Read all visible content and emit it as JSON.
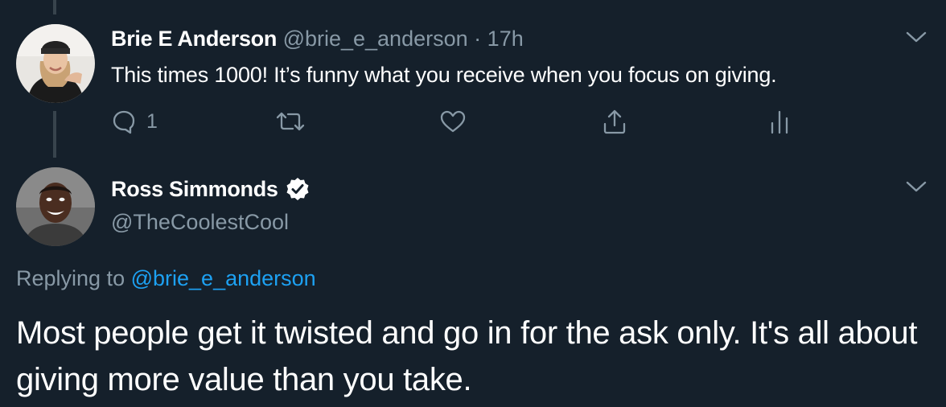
{
  "tweet1": {
    "name": "Brie E Anderson",
    "handle": "@brie_e_anderson",
    "separator": "·",
    "time": "17h",
    "text": "This times 1000! It’s funny what you receive when you focus on giving.",
    "actions": {
      "reply_icon": "reply-bubble-icon",
      "reply_count": "1",
      "retweet_icon": "retweet-icon",
      "like_icon": "heart-icon",
      "share_icon": "share-icon",
      "analytics_icon": "analytics-bars-icon"
    }
  },
  "tweet2": {
    "name": "Ross Simmonds",
    "verified_icon": "verified-badge-icon",
    "handle": "@TheCoolestCool",
    "replying_prefix": "Replying to",
    "replying_handle": "@brie_e_anderson",
    "text": "Most people get it twisted and go in for the ask only. It's all about giving more value than you take."
  },
  "colors": {
    "background": "#15202b",
    "muted": "#8899a6",
    "link": "#1da1f2",
    "thread_line": "#38444d"
  }
}
